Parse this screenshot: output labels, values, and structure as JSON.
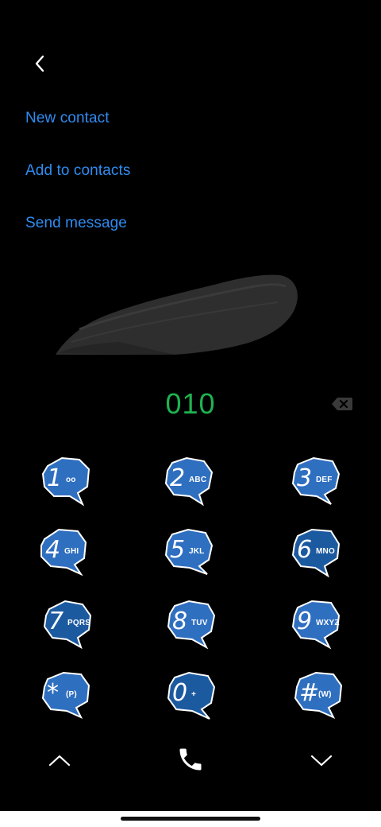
{
  "header": {
    "back_icon": "chevron-left-icon"
  },
  "actions": [
    {
      "label": "New contact"
    },
    {
      "label": "Add to contacts"
    },
    {
      "label": "Send message"
    }
  ],
  "dialer": {
    "number": "010",
    "backspace_icon": "backspace-icon"
  },
  "keys": [
    {
      "digit": "1",
      "letters": "oo"
    },
    {
      "digit": "2",
      "letters": "ABC"
    },
    {
      "digit": "3",
      "letters": "DEF"
    },
    {
      "digit": "4",
      "letters": "GHI"
    },
    {
      "digit": "5",
      "letters": "JKL"
    },
    {
      "digit": "6",
      "letters": "MNO"
    },
    {
      "digit": "7",
      "letters": "PQRS"
    },
    {
      "digit": "8",
      "letters": "TUV"
    },
    {
      "digit": "9",
      "letters": "WXYZ"
    },
    {
      "digit": "*",
      "letters": "(P)"
    },
    {
      "digit": "0",
      "letters": "+"
    },
    {
      "digit": "#",
      "letters": "(W)"
    }
  ],
  "bottom": {
    "up_icon": "chevron-up-icon",
    "call_icon": "phone-icon",
    "down_icon": "chevron-down-icon"
  },
  "colors": {
    "accent": "#2f8cf0",
    "number": "#1fb34f",
    "key_fill": "#2f6fc0",
    "key_fill_dark": "#1c5aa0"
  }
}
